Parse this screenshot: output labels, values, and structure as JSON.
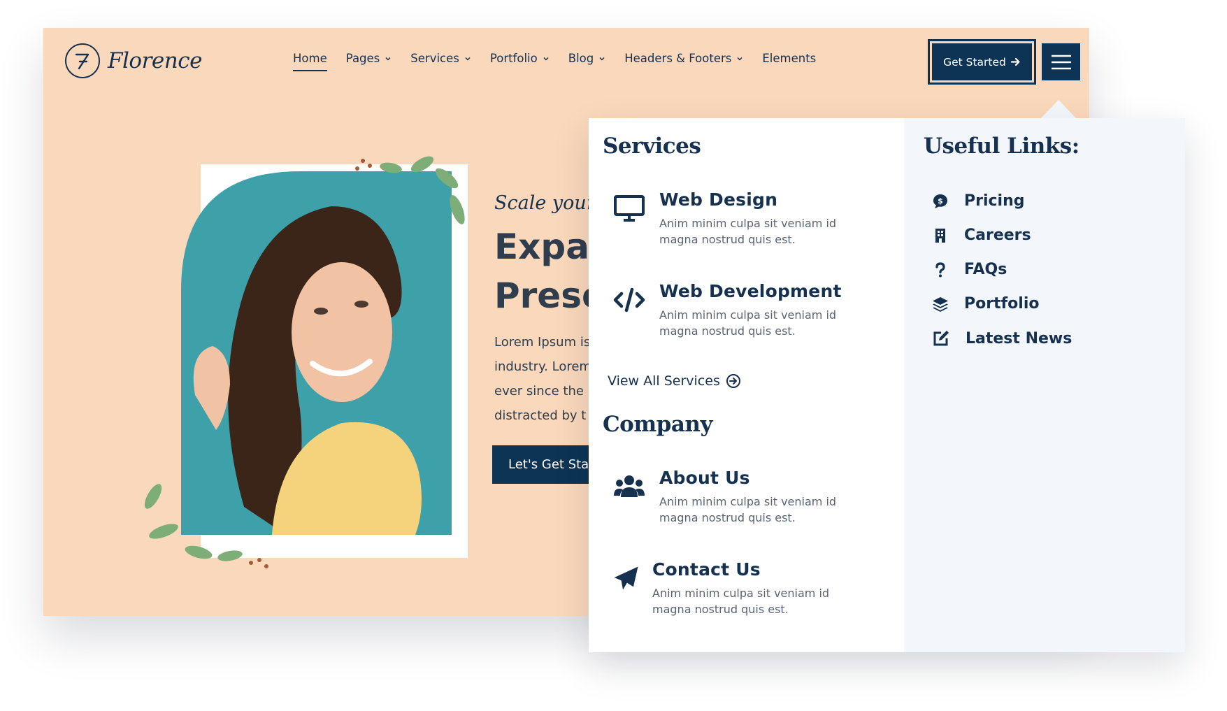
{
  "brand": {
    "name": "Florence"
  },
  "nav": {
    "items": [
      {
        "label": "Home",
        "dropdown": false,
        "active": true
      },
      {
        "label": "Pages",
        "dropdown": true
      },
      {
        "label": "Services",
        "dropdown": true
      },
      {
        "label": "Portfolio",
        "dropdown": true
      },
      {
        "label": "Blog",
        "dropdown": true
      },
      {
        "label": "Headers & Footers",
        "dropdown": true
      },
      {
        "label": "Elements",
        "dropdown": false
      }
    ],
    "cta_label": "Get Started",
    "menu_icon": "hamburger-icon"
  },
  "hero": {
    "tagline": "Scale your B",
    "title": "Expa\nPrese",
    "body": "Lorem Ipsum is\nindustry. Lorem\never since the\ndistracted by t",
    "cta_label": "Let's Get Sta"
  },
  "mega_menu": {
    "services_heading": "Services",
    "services": [
      {
        "title": "Web Design",
        "description": "Anim minim culpa sit veniam id\nmagna nostrud quis est.",
        "icon": "monitor-icon"
      },
      {
        "title": "Web Development",
        "description": "Anim minim culpa sit veniam id\nmagna nostrud quis est.",
        "icon": "code-icon"
      }
    ],
    "view_all_label": "View All Services",
    "company_heading": "Company",
    "company": [
      {
        "title": "About Us",
        "description": "Anim minim culpa sit veniam id\nmagna nostrud quis est.",
        "icon": "users-icon"
      },
      {
        "title": "Contact Us",
        "description": "Anim minim culpa sit veniam id\nmagna nostrud quis est.",
        "icon": "paper-plane-icon"
      }
    ],
    "links_heading": "Useful Links:",
    "links": [
      {
        "label": "Pricing",
        "icon": "dollar-comment-icon"
      },
      {
        "label": "Careers",
        "icon": "building-icon"
      },
      {
        "label": "FAQs",
        "icon": "question-icon"
      },
      {
        "label": "Portfolio",
        "icon": "layers-icon"
      },
      {
        "label": "Latest News",
        "icon": "edit-icon"
      }
    ]
  },
  "colors": {
    "background": "#fad8bb",
    "primary": "#0d3454",
    "text": "#16304f",
    "hero_photo_bg": "#3ea1a9",
    "dropdown_bg": "#ffffff",
    "dropdown_side_bg": "#f3f7fc"
  }
}
